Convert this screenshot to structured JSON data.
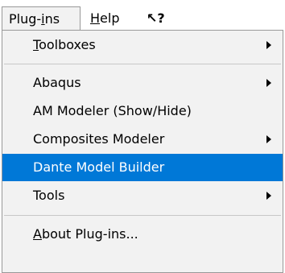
{
  "menubar": {
    "plugins_pre": "Plug-",
    "plugins_u": "i",
    "plugins_post": "ns",
    "help_u": "H",
    "help_post": "elp",
    "whats_this": "↖?"
  },
  "menu": {
    "items": [
      {
        "pre": "",
        "u": "T",
        "post": "oolboxes",
        "submenu": true
      },
      {
        "pre": "Abaqus",
        "u": "",
        "post": "",
        "submenu": true
      },
      {
        "pre": "AM Modeler (Show/Hide)",
        "u": "",
        "post": "",
        "submenu": false
      },
      {
        "pre": "Composites Modeler",
        "u": "",
        "post": "",
        "submenu": true
      },
      {
        "pre": "Dante Model Builder",
        "u": "",
        "post": "",
        "submenu": false,
        "selected": true
      },
      {
        "pre": "Tools",
        "u": "",
        "post": "",
        "submenu": true
      },
      {
        "pre": "",
        "u": "A",
        "post": "bout Plug-ins...",
        "submenu": false
      }
    ]
  },
  "colors": {
    "selection": "#0078d7",
    "menu_bg": "#f2f2f2"
  }
}
